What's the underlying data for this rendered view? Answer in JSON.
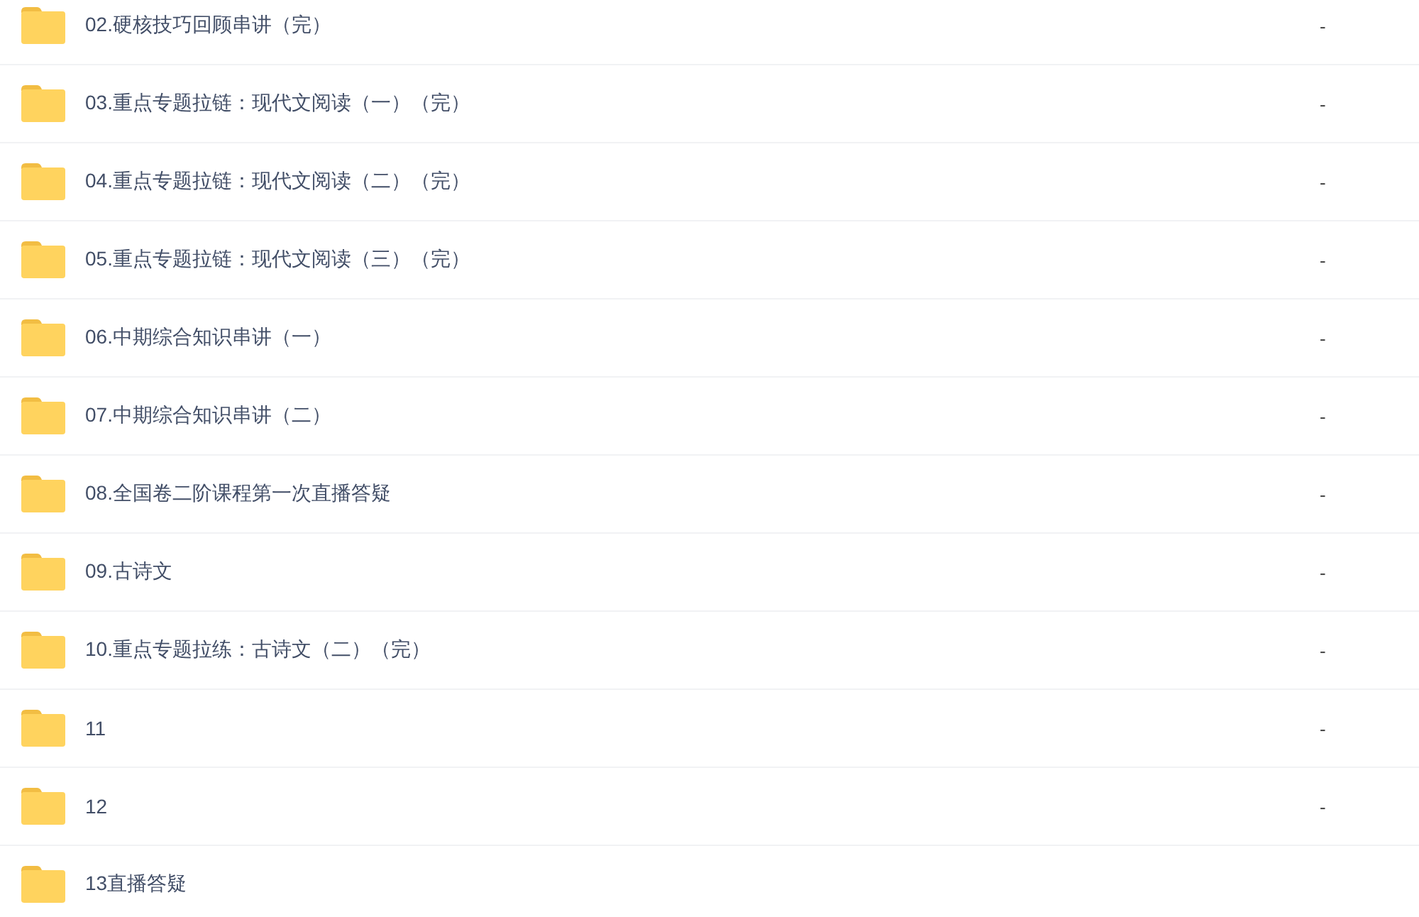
{
  "files": [
    {
      "name": "02.硬核技巧回顾串讲（完）",
      "size": "-"
    },
    {
      "name": "03.重点专题拉链：现代文阅读（一）（完）",
      "size": "-"
    },
    {
      "name": "04.重点专题拉链：现代文阅读（二）（完）",
      "size": "-"
    },
    {
      "name": "05.重点专题拉链：现代文阅读（三）（完）",
      "size": "-"
    },
    {
      "name": "06.中期综合知识串讲（一）",
      "size": "-"
    },
    {
      "name": "07.中期综合知识串讲（二）",
      "size": "-"
    },
    {
      "name": "08.全国卷二阶课程第一次直播答疑",
      "size": "-"
    },
    {
      "name": "09.古诗文",
      "size": "-"
    },
    {
      "name": "10.重点专题拉练：古诗文（二）（完）",
      "size": "-"
    },
    {
      "name": "11",
      "size": "-"
    },
    {
      "name": "12",
      "size": "-"
    },
    {
      "name": "13直播答疑"
    }
  ]
}
